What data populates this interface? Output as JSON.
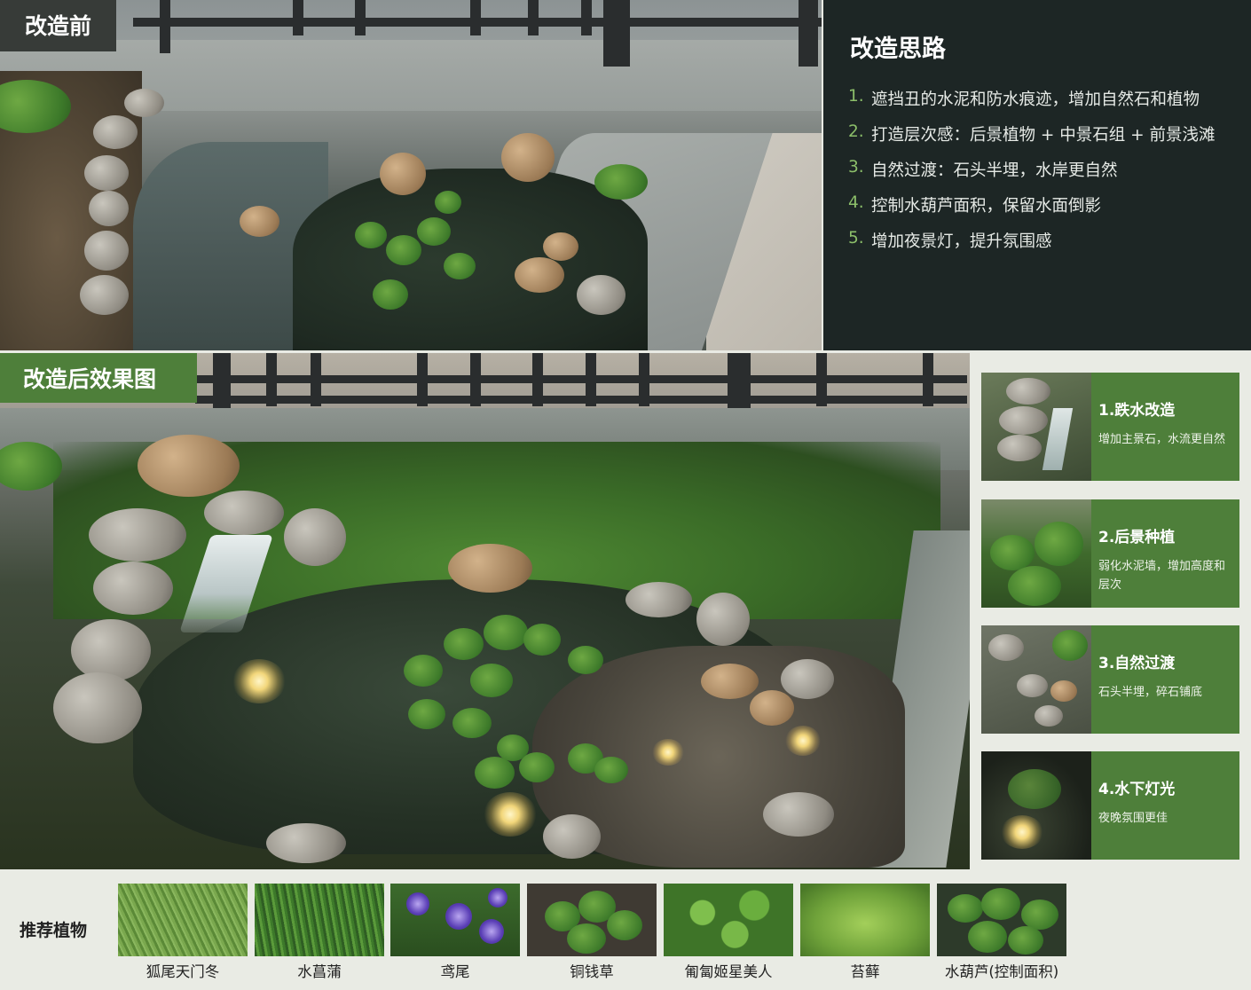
{
  "before": {
    "label": "改造前"
  },
  "ideas": {
    "title": "改造思路",
    "items": [
      {
        "num": "1.",
        "text": "遮挡丑的水泥和防水痕迹，增加自然石和植物"
      },
      {
        "num": "2.",
        "text": "打造层次感：后景植物 + 中景石组 + 前景浅滩"
      },
      {
        "num": "3.",
        "text": "自然过渡：石头半埋，水岸更自然"
      },
      {
        "num": "4.",
        "text": "控制水葫芦面积，保留水面倒影"
      },
      {
        "num": "5.",
        "text": "增加夜景灯，提升氛围感"
      }
    ]
  },
  "after": {
    "label": "改造后效果图"
  },
  "features": [
    {
      "title": "1.跌水改造",
      "desc": "增加主景石，水流更自然"
    },
    {
      "title": "2.后景种植",
      "desc": "弱化水泥墙，增加高度和层次"
    },
    {
      "title": "3.自然过渡",
      "desc": "石头半埋，碎石铺底"
    },
    {
      "title": "4.水下灯光",
      "desc": "夜晚氛围更佳"
    }
  ],
  "plants": {
    "label": "推荐植物",
    "items": [
      {
        "name": "狐尾天门冬"
      },
      {
        "name": "水菖蒲"
      },
      {
        "name": "鸢尾"
      },
      {
        "name": "铜钱草"
      },
      {
        "name": "匍匐姬星美人"
      },
      {
        "name": "苔藓"
      },
      {
        "name": "水葫芦(控制面积)"
      }
    ]
  },
  "colors": {
    "accent_green": "#4e7f3a",
    "ideas_bg": "#1d2625",
    "number_green": "#8cbf6a",
    "page_bg": "#e9ebe4"
  }
}
